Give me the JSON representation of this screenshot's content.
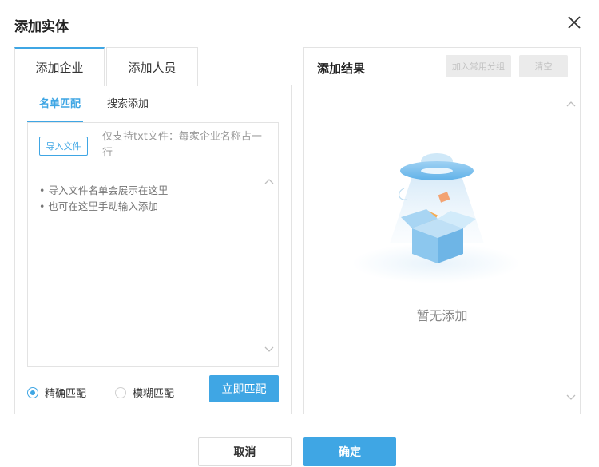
{
  "dialog": {
    "title": "添加实体"
  },
  "left": {
    "tabs": [
      {
        "label": "添加企业"
      },
      {
        "label": "添加人员"
      }
    ],
    "subtabs": [
      {
        "label": "名单匹配"
      },
      {
        "label": "搜索添加"
      }
    ],
    "import_button": "导入文件",
    "import_hint": "仅支持txt文件：每家企业名称占一行",
    "textarea_placeholder": "• 导入文件名单会展示在这里\n• 也可在这里手动输入添加",
    "radios": [
      {
        "label": "精确匹配",
        "checked": true
      },
      {
        "label": "模糊匹配",
        "checked": false
      }
    ],
    "match_button": "立即匹配"
  },
  "right": {
    "title": "添加结果",
    "add_group_button": "加入常用分组",
    "clear_button": "清空",
    "empty_text": "暂无添加"
  },
  "footer": {
    "cancel": "取消",
    "confirm": "确定"
  },
  "colors": {
    "accent": "#3fa6e4",
    "border": "#e3e3e3",
    "disabled_bg": "#ebebeb"
  }
}
